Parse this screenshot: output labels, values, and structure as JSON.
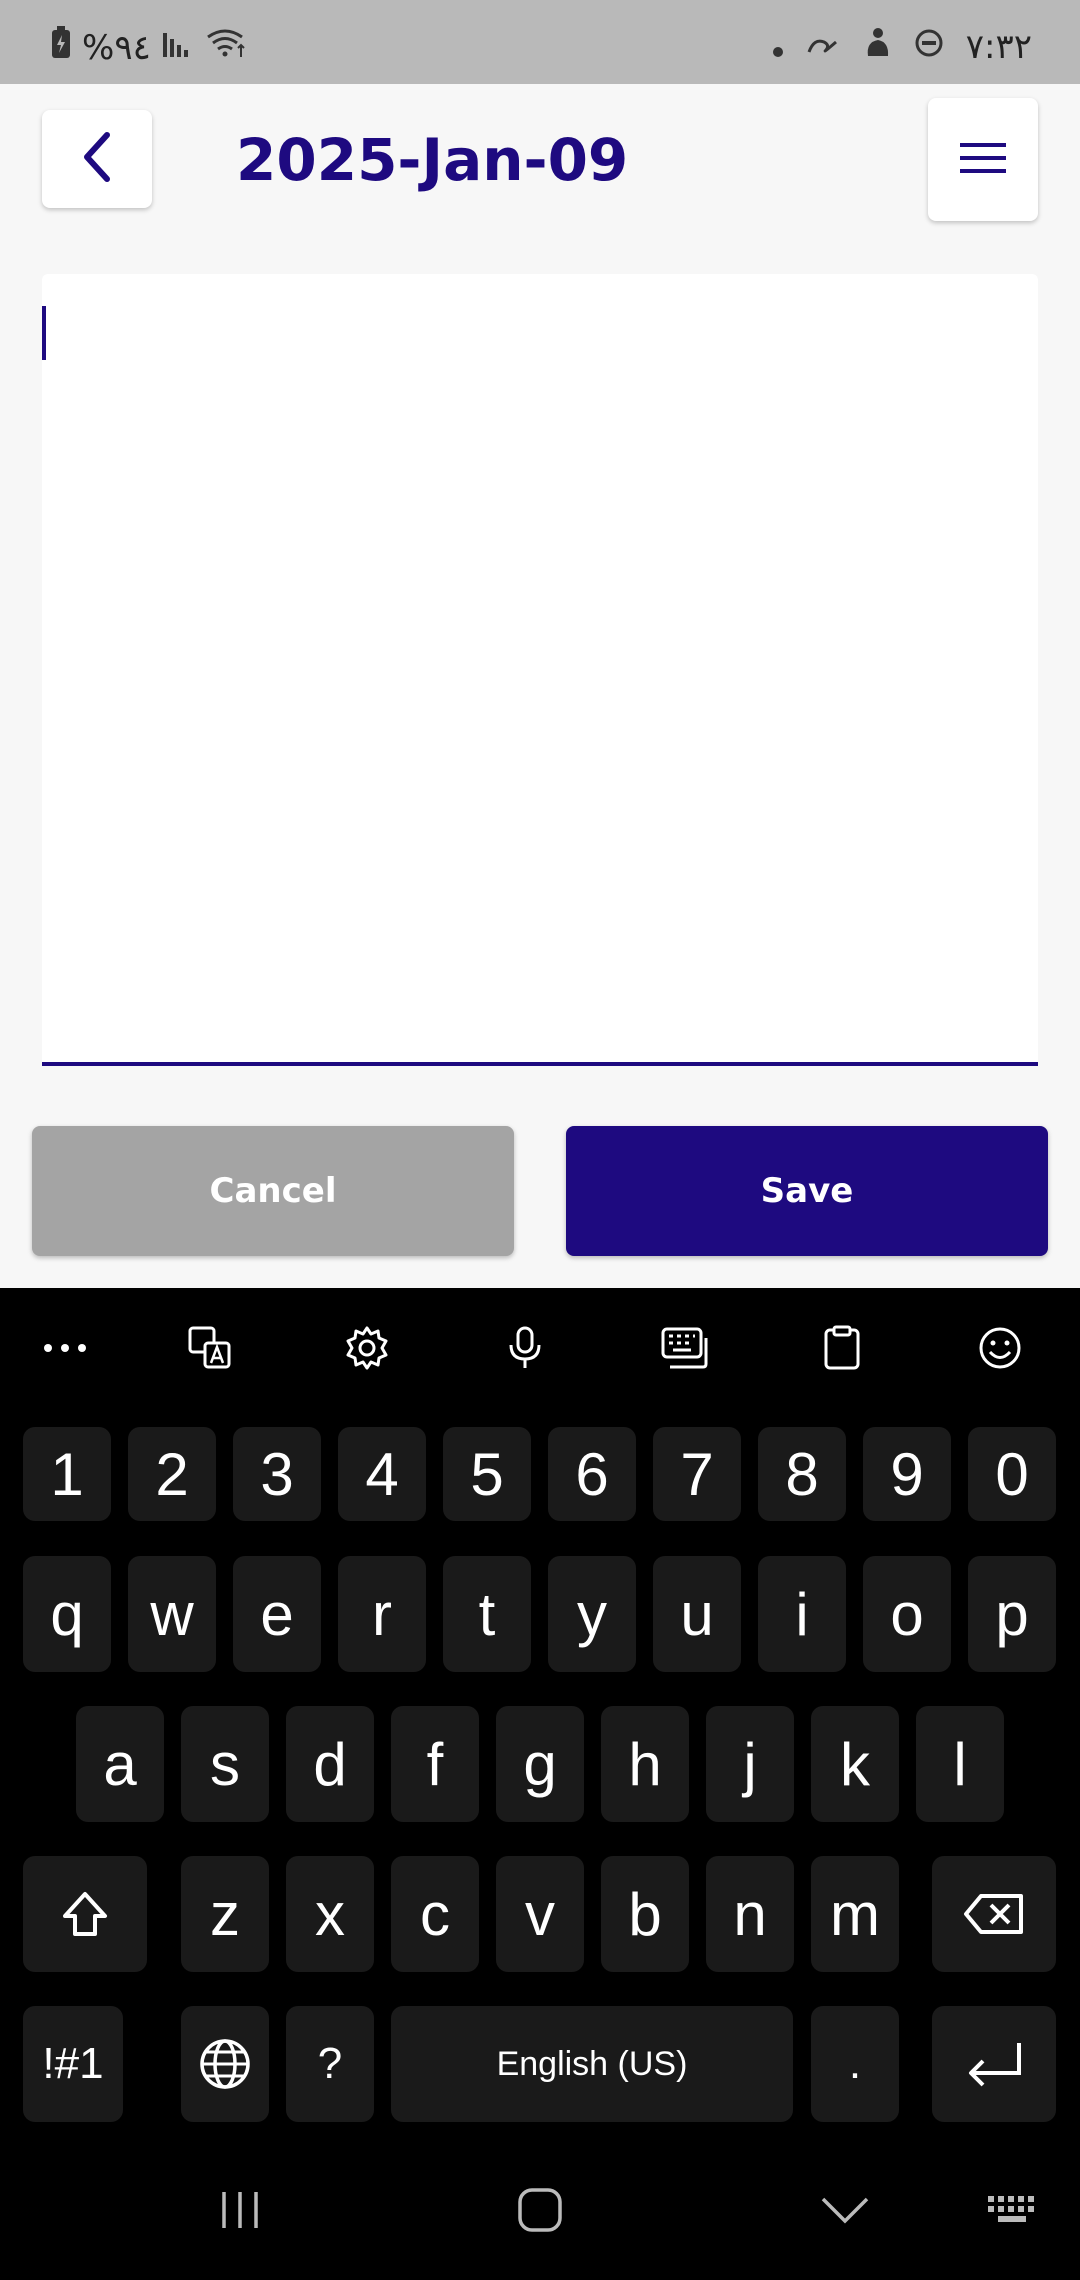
{
  "status_bar": {
    "battery_percent": "%٩٤",
    "time": "٧:٣٢"
  },
  "header": {
    "title": "2025-Jan-09"
  },
  "editor": {
    "value": "",
    "placeholder": ""
  },
  "actions": {
    "cancel_label": "Cancel",
    "save_label": "Save"
  },
  "keyboard": {
    "numbers": [
      "1",
      "2",
      "3",
      "4",
      "5",
      "6",
      "7",
      "8",
      "9",
      "0"
    ],
    "row1": [
      "q",
      "w",
      "e",
      "r",
      "t",
      "y",
      "u",
      "i",
      "o",
      "p"
    ],
    "row2": [
      "a",
      "s",
      "d",
      "f",
      "g",
      "h",
      "j",
      "k",
      "l"
    ],
    "row3": [
      "z",
      "x",
      "c",
      "v",
      "b",
      "n",
      "m"
    ],
    "symbols_label": "!#1",
    "question_label": "?",
    "space_label": "English (US)",
    "period_label": ".",
    "toolbar": [
      "more-icon",
      "translate-icon",
      "settings-icon",
      "microphone-icon",
      "keyboard-mode-icon",
      "clipboard-icon",
      "emoji-icon"
    ]
  },
  "colors": {
    "accent": "#1e0a80",
    "cancel": "#a4a4a4",
    "status_bar": "#b9b9b9"
  }
}
